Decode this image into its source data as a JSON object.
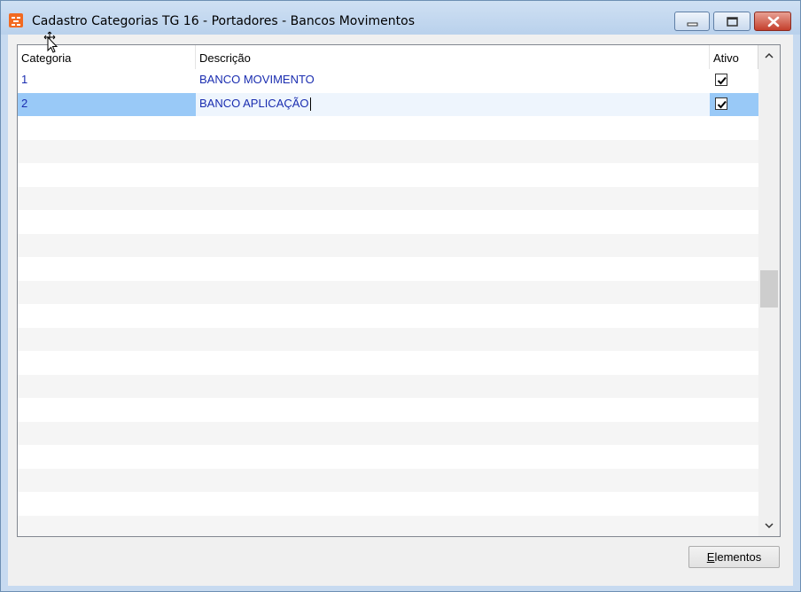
{
  "window": {
    "title": "Cadastro Categorias TG 16 - Portadores - Bancos Movimentos",
    "accent_color": "#c7daf0",
    "close_color": "#c43f2c",
    "icons": [
      "app-icon",
      "minimize-icon",
      "maximize-icon",
      "close-icon"
    ]
  },
  "grid": {
    "columns": [
      "Categoria",
      "Descrição",
      "Ativo"
    ],
    "rows": [
      {
        "categoria": "1",
        "descricao": "BANCO MOVIMENTO",
        "ativo": true,
        "selected": false
      },
      {
        "categoria": "2",
        "descricao": "BANCO APLICAÇÃO",
        "ativo": true,
        "selected": true
      }
    ],
    "text_color": "#1a2db0",
    "selected_color": "#99c9f7"
  },
  "footer": {
    "elementos_first_letter": "E",
    "elementos_rest": "lementos"
  }
}
